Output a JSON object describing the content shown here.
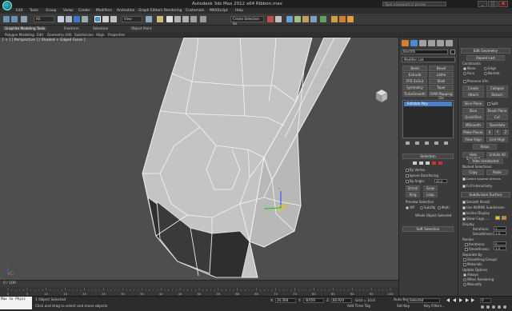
{
  "window": {
    "title": "Autodesk 3ds Max 2012 x64     Ribbon.max",
    "search_placeholder": "Type a keyword or phrase",
    "controls": [
      "_",
      "□",
      "×"
    ]
  },
  "menu": [
    "Edit",
    "Tools",
    "Group",
    "Views",
    "Create",
    "Modifiers",
    "Animation",
    "Graph Editors",
    "Rendering",
    "Customize",
    "MAXScript",
    "Help"
  ],
  "toolbar": {
    "selection_filter": "All",
    "reference_coord": "View",
    "named_selection": "Create Selection Se"
  },
  "ribbon": {
    "tabs": [
      "Graphite Modeling Tools",
      "Freeform",
      "Selection",
      "Object Paint"
    ],
    "subtabs": [
      "Polygon Modeling",
      "Edit",
      "Geometry (All)",
      "Subdivision",
      "Align",
      "Properties"
    ]
  },
  "viewport": {
    "label": "[ + ] [ Perspective ] [ Shaded + Edged Faces ]",
    "label_parts": [
      "[ + ]",
      "[ Perspective ]",
      "[ Shaded + Edged Faces ]"
    ]
  },
  "timeline": {
    "readout": "0 / 100",
    "ticks": [
      "0",
      "5",
      "10",
      "15",
      "20",
      "25",
      "30",
      "35",
      "40",
      "45",
      "50",
      "55",
      "60",
      "65",
      "70",
      "75",
      "80",
      "85",
      "90",
      "95",
      "100"
    ]
  },
  "status": {
    "maxscript": "Max to Physc",
    "selected": "1 Object Selected",
    "prompt": "Click and drag to select and move objects",
    "x_label": "X:",
    "x_value": "34.308",
    "y_label": "Y:",
    "y_value": "-8.659",
    "z_label": "Z:",
    "z_value": "84.920",
    "grid": "Grid = 10.0",
    "autokey": "Auto Key",
    "setkey": "Set Key",
    "key_mode": "Selected",
    "key_filters": "Key Filters...",
    "add_time_tag": "Add Time Tag",
    "frame": "0"
  },
  "command_panel": {
    "object_name": "Box006",
    "modifier_list": "Modifier List",
    "mod_buttons": [
      "Bend",
      "Bevel",
      "Extrude",
      "Lathe",
      "FFD 3x3x3",
      "Shell",
      "Symmetry",
      "Taper",
      "TurboSmooth",
      "UVW Mapping Cle"
    ],
    "stack_item": "Editable Poly",
    "selection_rollout": "Selection",
    "by_vertex": "By Vertex",
    "ignore_backfacing": "Ignore Backfacing",
    "by_angle": "By Angle:",
    "by_angle_value": "45.0",
    "shrink": "Shrink",
    "grow": "Grow",
    "ring": "Ring",
    "loop": "Loop",
    "preview_selection": "Preview Selection",
    "preview_opts": [
      "Off",
      "SubObj",
      "Multi"
    ],
    "whole_object": "Whole Object Selected",
    "soft_selection": "Soft Selection"
  },
  "right_panel": {
    "edit_geometry": "Edit Geometry",
    "repeat_last": "Repeat Last",
    "constraints": "Constraints",
    "constraint_opts": [
      "None",
      "Edge",
      "Face",
      "Normal"
    ],
    "preserve_uvs": "Preserve UVs",
    "create": "Create",
    "collapse": "Collapse",
    "attach": "Attach",
    "detach": "Detach",
    "slice_plane": "Slice Plane",
    "split": "Split",
    "slice": "Slice",
    "reset_plane": "Reset Plane",
    "quickslice": "QuickSlice",
    "cut": "Cut",
    "msmooth": "MSmooth",
    "tessellate": "Tessellate",
    "make_planar": "Make Planar",
    "xyz": [
      "X",
      "Y",
      "Z"
    ],
    "view_align": "View Align",
    "grid_align": "Grid Align",
    "relax": "Relax",
    "hide_selected": "Hide Selected",
    "unhide_all": "Unhide All",
    "hide_unselected": "Hide Unselected",
    "named_selections": "Named Selections:",
    "copy": "Copy",
    "paste": "Paste",
    "delete_isolated": "Delete Isolated Vertices",
    "full_interactivity": "Full Interactivity",
    "subdivision_surface": "Subdivision Surface",
    "smooth_result": "Smooth Result",
    "use_nurms": "Use NURMS Subdivision",
    "isoline_display": "Isoline Display",
    "show_cage": "Show Cage......",
    "display": "Display",
    "iterations": "Iterations:",
    "iterations_value": "1",
    "smoothness": "Smoothness:",
    "smoothness_value": "1.0",
    "render": "Render",
    "render_iterations_value": "0",
    "render_smoothness_value": "1.0",
    "separate_by": "Separate By",
    "smoothing_groups": "Smoothing Groups",
    "materials": "Materials",
    "update_options": "Update Options",
    "update_opts": [
      "Always",
      "When Rendering",
      "Manually"
    ],
    "cage_colors": [
      "#f0c000",
      "#f08000"
    ]
  }
}
